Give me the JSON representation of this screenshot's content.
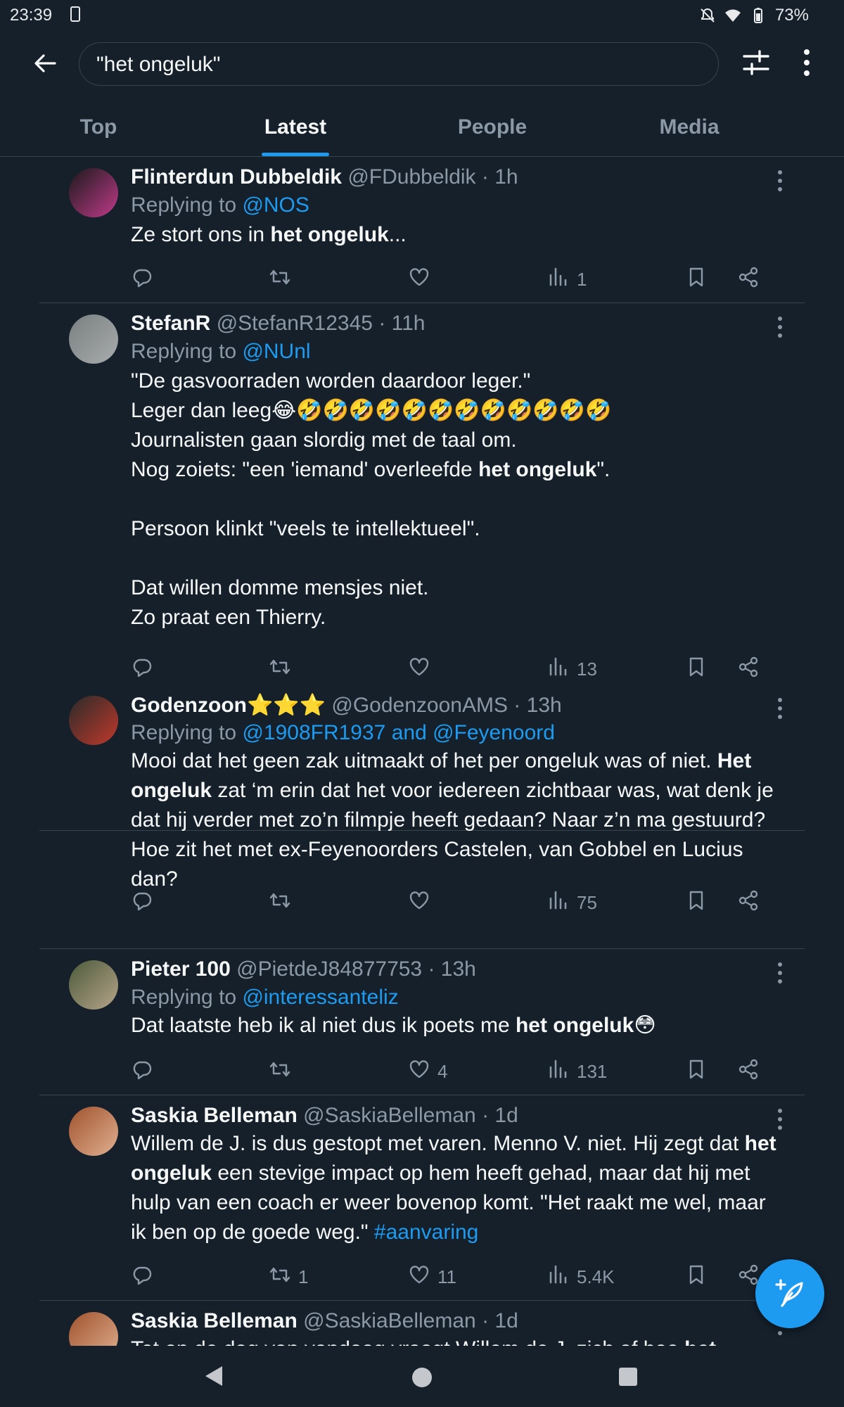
{
  "status_bar": {
    "time": "23:39",
    "battery": "73%"
  },
  "search": {
    "value": "\"het ongeluk\""
  },
  "tabs": [
    {
      "label": "Top"
    },
    {
      "label": "Latest"
    },
    {
      "label": "People"
    },
    {
      "label": "Media"
    }
  ],
  "tabs_active": "Latest",
  "tweets": [
    {
      "name": "Flinterdun Dubbeldik",
      "handle": "@FDubbeldik",
      "time": "1h",
      "replying_prefix": "Replying to",
      "replying_to": "@NOS",
      "body_html": "Ze stort ons in <b>het ongeluk</b>...",
      "retweets": "",
      "likes": "",
      "views": "1"
    },
    {
      "name": "StefanR",
      "handle": "@StefanR12345",
      "time": "11h",
      "replying_prefix": "Replying to",
      "replying_to": "@NUnl",
      "body_html": "\"De gasvoorraden worden daardoor leger.\"<br>Leger dan leeg😂🤣🤣🤣🤣🤣🤣🤣🤣🤣🤣🤣🤣<br>Journalisten gaan slordig met de taal om.<br>Nog zoiets: \"een 'iemand' overleefde <b>het ongeluk</b>\".<br><br>Persoon klinkt \"veels te intellektueel\".<br><br>Dat willen domme mensjes niet.<br>Zo praat een Thierry.",
      "retweets": "",
      "likes": "",
      "views": "13"
    },
    {
      "name": "Godenzoon⭐⭐⭐",
      "handle": "@GodenzoonAMS",
      "time": "13h",
      "replying_prefix": "Replying to",
      "replying_to": "@1908FR1937 and @Feyenoord",
      "body_html": "Mooi dat het geen zak uitmaakt of het per ongeluk was of niet. <b>Het ongeluk</b> zat ‘m erin dat het voor iedereen zichtbaar was, wat denk je dat hij verder met zo’n filmpje heeft gedaan? Naar z’n ma gestuurd? Hoe zit het met ex-Feyenoorders Castelen, van Gobbel en Lucius dan?",
      "retweets": "",
      "likes": "",
      "views": "75"
    },
    {
      "name": "Pieter 100",
      "handle": "@PietdeJ84877753",
      "time": "13h",
      "replying_prefix": "Replying to",
      "replying_to": "@interessanteliz",
      "body_html": "Dat laatste heb ik al niet dus ik poets me <b>het ongeluk</b>😳",
      "retweets": "",
      "likes": "4",
      "views": "131"
    },
    {
      "name": "Saskia Belleman",
      "handle": "@SaskiaBelleman",
      "time": "1d",
      "replying_prefix": "",
      "replying_to": "",
      "body_html": "Willem de J. is dus gestopt met varen. Menno V. niet. Hij zegt dat <b>het ongeluk</b> een stevige impact op hem heeft gehad, maar dat hij met hulp van een coach er weer bovenop komt. \"Het raakt me wel, maar ik ben op de goede weg.\" <span class=\"t-link\">#aanvaring</span>",
      "retweets": "1",
      "likes": "11",
      "views": "5.4K"
    },
    {
      "name": "Saskia Belleman",
      "handle": "@SaskiaBelleman",
      "time": "1d",
      "replying_prefix": "",
      "replying_to": "",
      "body_html": "Tot op de dag van vandaag vraagt Willem de J. zich af hoe <b>het</b>",
      "retweets": "",
      "likes": "",
      "views": ""
    }
  ],
  "colors": {
    "background": "#15202b",
    "accent": "#1d9bf0",
    "muted": "#8b98a5",
    "divider": "#38444d"
  }
}
